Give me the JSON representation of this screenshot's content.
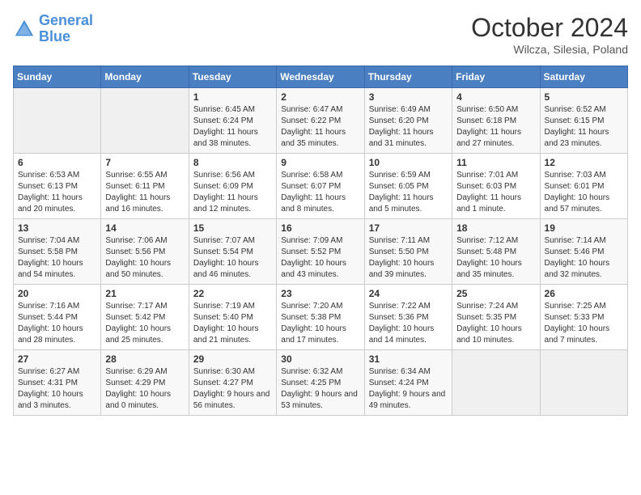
{
  "header": {
    "logo_line1": "General",
    "logo_line2": "Blue",
    "month": "October 2024",
    "location": "Wilcza, Silesia, Poland"
  },
  "days_of_week": [
    "Sunday",
    "Monday",
    "Tuesday",
    "Wednesday",
    "Thursday",
    "Friday",
    "Saturday"
  ],
  "weeks": [
    [
      {
        "day": "",
        "info": ""
      },
      {
        "day": "",
        "info": ""
      },
      {
        "day": "1",
        "info": "Sunrise: 6:45 AM\nSunset: 6:24 PM\nDaylight: 11 hours and 38 minutes."
      },
      {
        "day": "2",
        "info": "Sunrise: 6:47 AM\nSunset: 6:22 PM\nDaylight: 11 hours and 35 minutes."
      },
      {
        "day": "3",
        "info": "Sunrise: 6:49 AM\nSunset: 6:20 PM\nDaylight: 11 hours and 31 minutes."
      },
      {
        "day": "4",
        "info": "Sunrise: 6:50 AM\nSunset: 6:18 PM\nDaylight: 11 hours and 27 minutes."
      },
      {
        "day": "5",
        "info": "Sunrise: 6:52 AM\nSunset: 6:15 PM\nDaylight: 11 hours and 23 minutes."
      }
    ],
    [
      {
        "day": "6",
        "info": "Sunrise: 6:53 AM\nSunset: 6:13 PM\nDaylight: 11 hours and 20 minutes."
      },
      {
        "day": "7",
        "info": "Sunrise: 6:55 AM\nSunset: 6:11 PM\nDaylight: 11 hours and 16 minutes."
      },
      {
        "day": "8",
        "info": "Sunrise: 6:56 AM\nSunset: 6:09 PM\nDaylight: 11 hours and 12 minutes."
      },
      {
        "day": "9",
        "info": "Sunrise: 6:58 AM\nSunset: 6:07 PM\nDaylight: 11 hours and 8 minutes."
      },
      {
        "day": "10",
        "info": "Sunrise: 6:59 AM\nSunset: 6:05 PM\nDaylight: 11 hours and 5 minutes."
      },
      {
        "day": "11",
        "info": "Sunrise: 7:01 AM\nSunset: 6:03 PM\nDaylight: 11 hours and 1 minute."
      },
      {
        "day": "12",
        "info": "Sunrise: 7:03 AM\nSunset: 6:01 PM\nDaylight: 10 hours and 57 minutes."
      }
    ],
    [
      {
        "day": "13",
        "info": "Sunrise: 7:04 AM\nSunset: 5:58 PM\nDaylight: 10 hours and 54 minutes."
      },
      {
        "day": "14",
        "info": "Sunrise: 7:06 AM\nSunset: 5:56 PM\nDaylight: 10 hours and 50 minutes."
      },
      {
        "day": "15",
        "info": "Sunrise: 7:07 AM\nSunset: 5:54 PM\nDaylight: 10 hours and 46 minutes."
      },
      {
        "day": "16",
        "info": "Sunrise: 7:09 AM\nSunset: 5:52 PM\nDaylight: 10 hours and 43 minutes."
      },
      {
        "day": "17",
        "info": "Sunrise: 7:11 AM\nSunset: 5:50 PM\nDaylight: 10 hours and 39 minutes."
      },
      {
        "day": "18",
        "info": "Sunrise: 7:12 AM\nSunset: 5:48 PM\nDaylight: 10 hours and 35 minutes."
      },
      {
        "day": "19",
        "info": "Sunrise: 7:14 AM\nSunset: 5:46 PM\nDaylight: 10 hours and 32 minutes."
      }
    ],
    [
      {
        "day": "20",
        "info": "Sunrise: 7:16 AM\nSunset: 5:44 PM\nDaylight: 10 hours and 28 minutes."
      },
      {
        "day": "21",
        "info": "Sunrise: 7:17 AM\nSunset: 5:42 PM\nDaylight: 10 hours and 25 minutes."
      },
      {
        "day": "22",
        "info": "Sunrise: 7:19 AM\nSunset: 5:40 PM\nDaylight: 10 hours and 21 minutes."
      },
      {
        "day": "23",
        "info": "Sunrise: 7:20 AM\nSunset: 5:38 PM\nDaylight: 10 hours and 17 minutes."
      },
      {
        "day": "24",
        "info": "Sunrise: 7:22 AM\nSunset: 5:36 PM\nDaylight: 10 hours and 14 minutes."
      },
      {
        "day": "25",
        "info": "Sunrise: 7:24 AM\nSunset: 5:35 PM\nDaylight: 10 hours and 10 minutes."
      },
      {
        "day": "26",
        "info": "Sunrise: 7:25 AM\nSunset: 5:33 PM\nDaylight: 10 hours and 7 minutes."
      }
    ],
    [
      {
        "day": "27",
        "info": "Sunrise: 6:27 AM\nSunset: 4:31 PM\nDaylight: 10 hours and 3 minutes."
      },
      {
        "day": "28",
        "info": "Sunrise: 6:29 AM\nSunset: 4:29 PM\nDaylight: 10 hours and 0 minutes."
      },
      {
        "day": "29",
        "info": "Sunrise: 6:30 AM\nSunset: 4:27 PM\nDaylight: 9 hours and 56 minutes."
      },
      {
        "day": "30",
        "info": "Sunrise: 6:32 AM\nSunset: 4:25 PM\nDaylight: 9 hours and 53 minutes."
      },
      {
        "day": "31",
        "info": "Sunrise: 6:34 AM\nSunset: 4:24 PM\nDaylight: 9 hours and 49 minutes."
      },
      {
        "day": "",
        "info": ""
      },
      {
        "day": "",
        "info": ""
      }
    ]
  ]
}
